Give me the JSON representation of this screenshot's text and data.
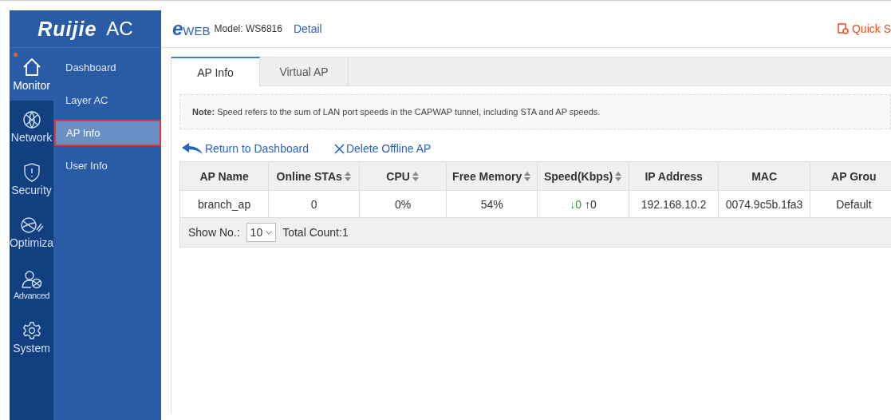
{
  "brand": {
    "logo": "Ruijie",
    "product": "AC"
  },
  "header": {
    "logo_mark": "e",
    "logo": "WEB",
    "model": "Model: WS6816",
    "detail_link": "Detail",
    "quick_link": "Quick S"
  },
  "nav_rail": [
    {
      "label": "Monitor",
      "kind": "home",
      "selected": true,
      "notify": true
    },
    {
      "label": "Network",
      "kind": "globe",
      "selected": false,
      "notify": false
    },
    {
      "label": "Security",
      "kind": "shield",
      "selected": false,
      "notify": false
    },
    {
      "label": "Optimiza",
      "kind": "rocket",
      "selected": false,
      "notify": false
    },
    {
      "label": "Advanced",
      "kind": "user",
      "selected": false,
      "notify": false
    },
    {
      "label": "System",
      "kind": "gear",
      "selected": false,
      "notify": false
    }
  ],
  "submenu": [
    {
      "label": "Dashboard",
      "selected": false
    },
    {
      "label": "Layer AC",
      "selected": false
    },
    {
      "label": "AP Info",
      "selected": true
    },
    {
      "label": "User Info",
      "selected": false
    }
  ],
  "tabs": [
    {
      "label": "AP Info",
      "selected": true
    },
    {
      "label": "Virtual AP",
      "selected": false
    }
  ],
  "note": "**Note:** Speed refers to the sum of LAN port speeds in the CAPWAP tunnel, including STA and AP speeds.",
  "actions": [
    {
      "kind": "back",
      "label": "Return to Dashboard"
    },
    {
      "kind": "delete",
      "label": "Delete Offline AP"
    }
  ],
  "table": {
    "columns": [
      {
        "label": "AP Name",
        "sortable": false
      },
      {
        "label": "Online STAs",
        "sortable": true
      },
      {
        "label": "CPU",
        "sortable": true
      },
      {
        "label": "Free Memory",
        "sortable": true
      },
      {
        "label": "Speed(Kbps)",
        "sortable": true
      },
      {
        "label": "IP Address",
        "sortable": false
      },
      {
        "label": "MAC",
        "sortable": false
      },
      {
        "label": "AP Grou",
        "sortable": false
      }
    ],
    "rows": [
      {
        "name": "branch_ap",
        "stas": "0",
        "cpu": "0%",
        "memory": "54%",
        "speed_down": "↓0",
        "speed_up": "↑0",
        "ip": "192.168.10.2",
        "mac": "0074.9c5b.1fa3",
        "group": "Default"
      }
    ]
  },
  "pager": {
    "show_label": "Show No.:",
    "page_size": "10",
    "total": "Total Count:1"
  }
}
